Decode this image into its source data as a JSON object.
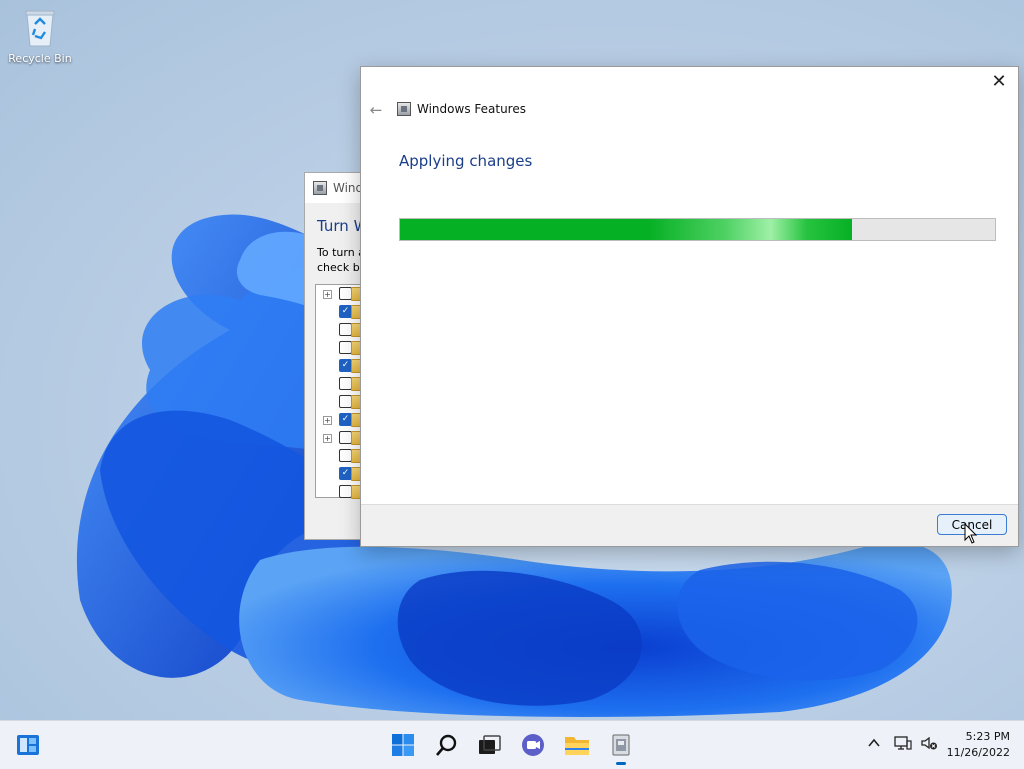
{
  "desktop": {
    "recycle_bin_label": "Recycle Bin"
  },
  "background_window": {
    "title": "Windo",
    "heading": "Turn W",
    "desc_line1": "To turn a",
    "desc_line2": "check bo",
    "tree_rows": [
      {
        "expand": true,
        "checked": false
      },
      {
        "expand": false,
        "checked": true
      },
      {
        "expand": false,
        "checked": false
      },
      {
        "expand": false,
        "checked": false
      },
      {
        "expand": false,
        "checked": true
      },
      {
        "expand": false,
        "checked": false
      },
      {
        "expand": false,
        "checked": false
      },
      {
        "expand": true,
        "checked": true
      },
      {
        "expand": true,
        "checked": false
      },
      {
        "expand": false,
        "checked": false
      },
      {
        "expand": false,
        "checked": true
      },
      {
        "expand": false,
        "checked": false
      }
    ]
  },
  "dialog": {
    "title": "Windows Features",
    "heading": "Applying changes",
    "progress_fraction": 0.76,
    "cancel_label": "Cancel",
    "close_glyph": "✕",
    "back_glyph": "←"
  },
  "taskbar": {
    "icons": [
      "widgets-icon",
      "start-icon",
      "search-icon",
      "task-view-icon",
      "chat-icon",
      "file-explorer-icon",
      "windows-features-icon"
    ],
    "time": "5:23 PM",
    "date": "11/26/2022"
  },
  "colors": {
    "accent": "#0067c0",
    "progress_green": "#06b025",
    "heading_blue": "#1a3e8a"
  }
}
